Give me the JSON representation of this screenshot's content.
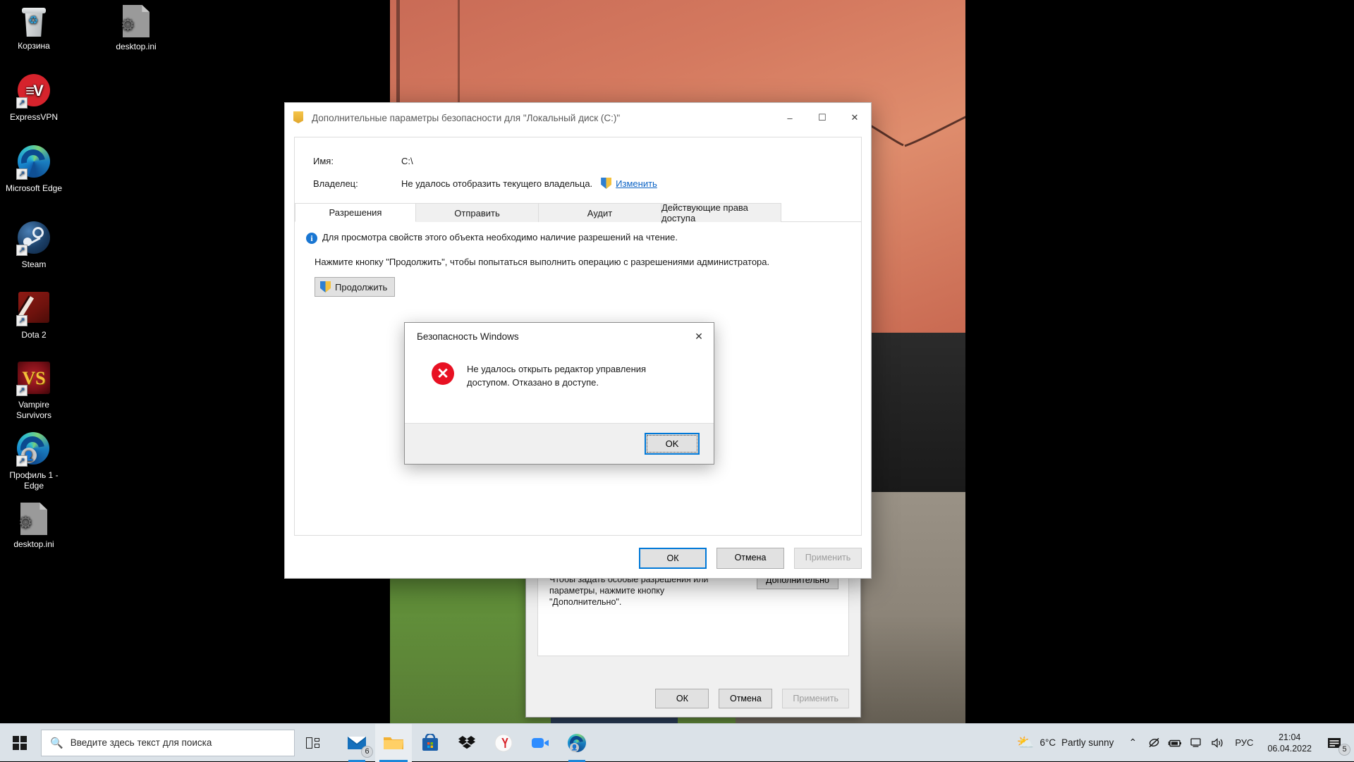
{
  "desktop": {
    "icons": [
      {
        "label": "Корзина",
        "icon": "recycle-bin-icon",
        "shortcut": false
      },
      {
        "label": "desktop.ini",
        "icon": "ini-file-icon",
        "shortcut": false
      },
      {
        "label": "ExpressVPN",
        "icon": "expressvpn-icon",
        "shortcut": true
      },
      {
        "label": "Microsoft Edge",
        "icon": "microsoft-edge-icon",
        "shortcut": true
      },
      {
        "label": "Steam",
        "icon": "steam-icon",
        "shortcut": true
      },
      {
        "label": "Dota 2",
        "icon": "dota2-icon",
        "shortcut": true
      },
      {
        "label": "Vampire Survivors",
        "icon": "vampire-survivors-icon",
        "shortcut": true
      },
      {
        "label": "Профиль 1 - Edge",
        "icon": "edge-profile-icon",
        "shortcut": true
      },
      {
        "label": "desktop.ini",
        "icon": "ini-file-icon",
        "shortcut": false
      }
    ]
  },
  "taskbar": {
    "start_label": "Пуск",
    "search_placeholder": "Введите здесь текст для поиска",
    "task_view_label": "Представление задач",
    "buttons": [
      {
        "name": "mail-taskbar-button",
        "badge": "6"
      },
      {
        "name": "file-explorer-taskbar-button",
        "badge": ""
      },
      {
        "name": "microsoft-store-taskbar-button",
        "badge": ""
      },
      {
        "name": "dropbox-taskbar-button",
        "badge": ""
      },
      {
        "name": "yandex-browser-taskbar-button",
        "badge": ""
      },
      {
        "name": "zoom-taskbar-button",
        "badge": ""
      },
      {
        "name": "edge-profile-taskbar-button",
        "badge": ""
      }
    ],
    "tray": {
      "weather_temp": "6°C",
      "weather_desc": "Partly sunny",
      "chevron": "⌃",
      "language": "РУС",
      "time": "21:04",
      "date": "06.04.2022",
      "notification_count": "5"
    }
  },
  "properties_window": {
    "hint_text": "Чтобы задать особые разрешения или параметры, нажмите кнопку \"Дополнительно\".",
    "advanced_button": "Дополнительно",
    "ok_button": "ОК",
    "cancel_button": "Отмена",
    "apply_button": "Применить"
  },
  "advanced_security": {
    "title": "Дополнительные параметры безопасности  для \"Локальный диск (C:)\"",
    "minimize_glyph": "–",
    "maximize_glyph": "☐",
    "close_glyph": "✕",
    "name_label": "Имя:",
    "name_value": "C:\\",
    "owner_label": "Владелец:",
    "owner_value": "Не удалось отобразить текущего владельца.",
    "owner_change_link": "Изменить",
    "tabs": [
      {
        "label": "Разрешения",
        "active": true
      },
      {
        "label": "Отправить",
        "active": false
      },
      {
        "label": "Аудит",
        "active": false
      },
      {
        "label": "Действующие права доступа",
        "active": false
      }
    ],
    "info_text": "Для просмотра свойств этого объекта необходимо наличие разрешений на чтение.",
    "info_glyph": "i",
    "hint_text": "Нажмите кнопку \"Продолжить\", чтобы попытаться выполнить операцию с разрешениями администратора.",
    "continue_button": "Продолжить",
    "ok_button": "ОК",
    "cancel_button": "Отмена",
    "apply_button": "Применить"
  },
  "error_dialog": {
    "title": "Безопасность Windows",
    "close_glyph": "✕",
    "icon_glyph": "✕",
    "message": "Не удалось открыть редактор управления доступом. Отказано в доступе.",
    "ok_button": "OK"
  },
  "colors": {
    "accent": "#0078d7",
    "error": "#e81123",
    "link": "#0b63c5",
    "taskbar": "#dbe2e8"
  }
}
